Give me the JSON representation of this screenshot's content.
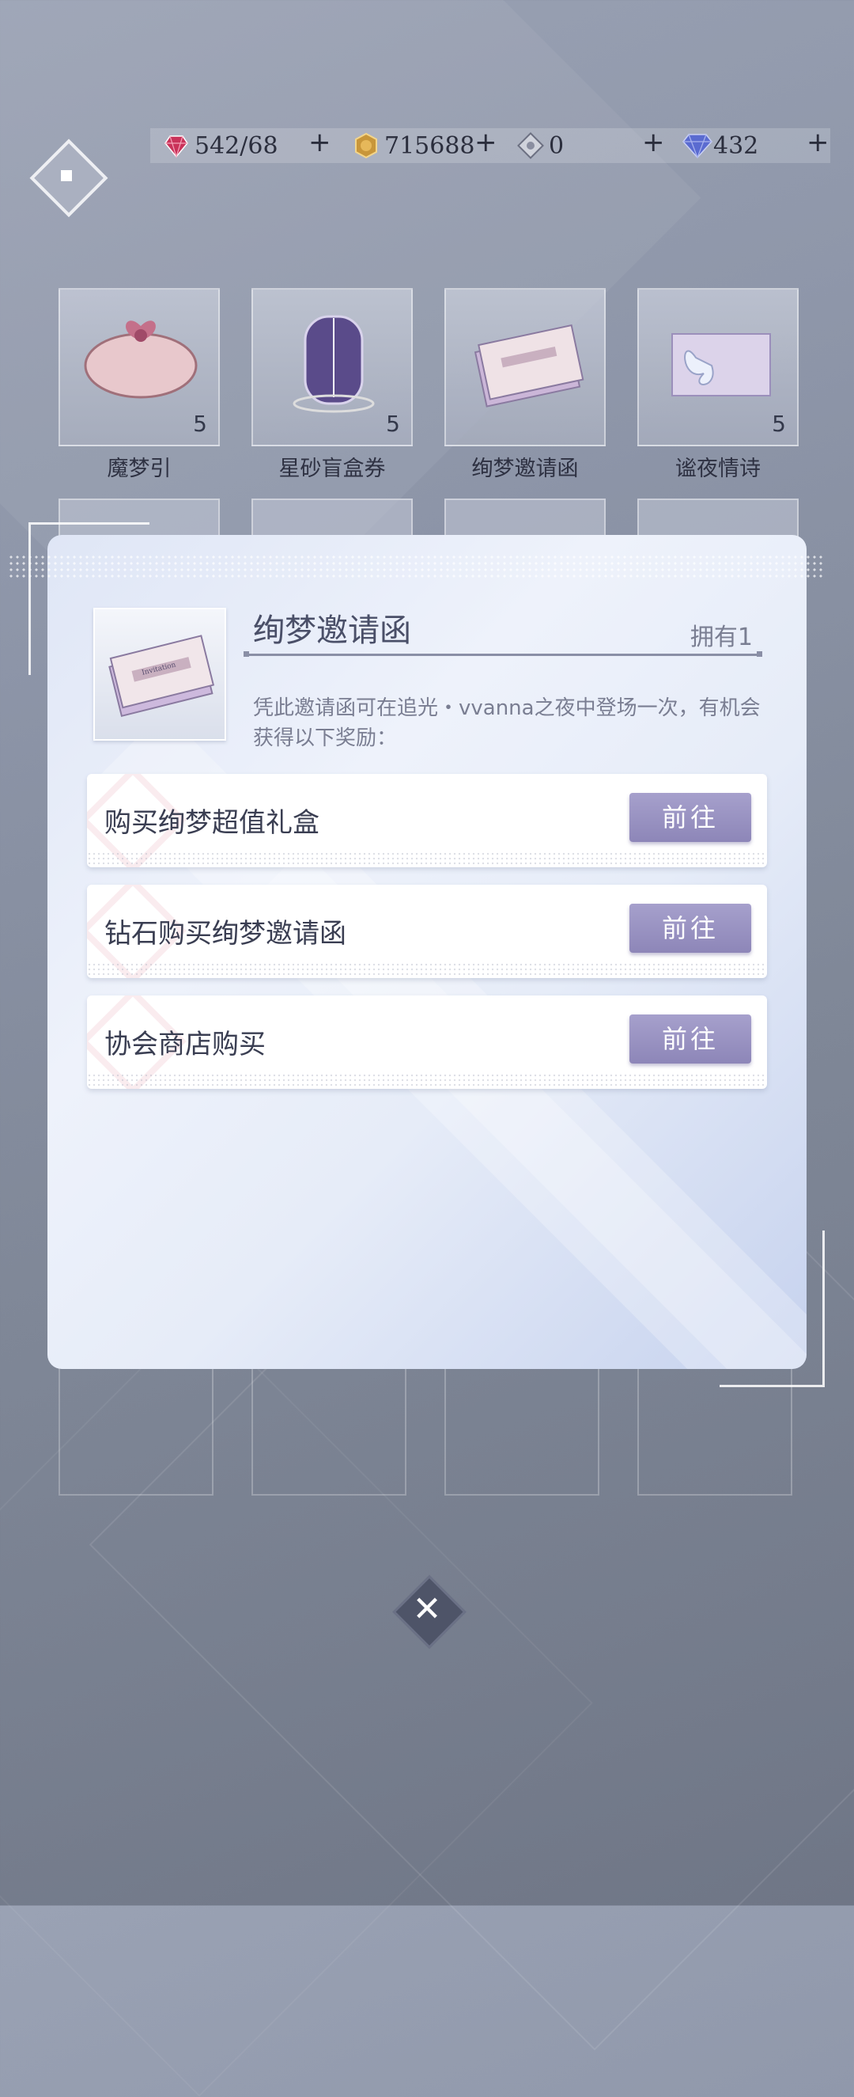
{
  "currencies": [
    {
      "icon": "heart-gem-icon",
      "value": "542/68",
      "color": "#c9325a"
    },
    {
      "icon": "gold-coin-icon",
      "value": "715688",
      "color": "#c8963a"
    },
    {
      "icon": "silver-crystal-icon",
      "value": "0",
      "color": "#8a8ea0"
    },
    {
      "icon": "diamond-icon",
      "value": "432",
      "color": "#5a6bd0"
    }
  ],
  "plus_label": "+",
  "items": [
    {
      "name": "魔梦引",
      "count": "5"
    },
    {
      "name": "星砂盲盒券",
      "count": "5"
    },
    {
      "name": "绚梦邀请函",
      "count": ""
    },
    {
      "name": "谧夜情诗",
      "count": "5"
    }
  ],
  "modal": {
    "title": "绚梦邀请函",
    "owned": "拥有1",
    "description": "凭此邀请函可在追光・vvanna之夜中登场一次，有机会获得以下奖励：",
    "thumb_text": "Invitation",
    "options": [
      {
        "label": "购买绚梦超值礼盒",
        "button": "前往"
      },
      {
        "label": "钻石购买绚梦邀请函",
        "button": "前往"
      },
      {
        "label": "协会商店购买",
        "button": "前往"
      }
    ]
  },
  "close_label": "✕",
  "accent_color": "#958fc2"
}
